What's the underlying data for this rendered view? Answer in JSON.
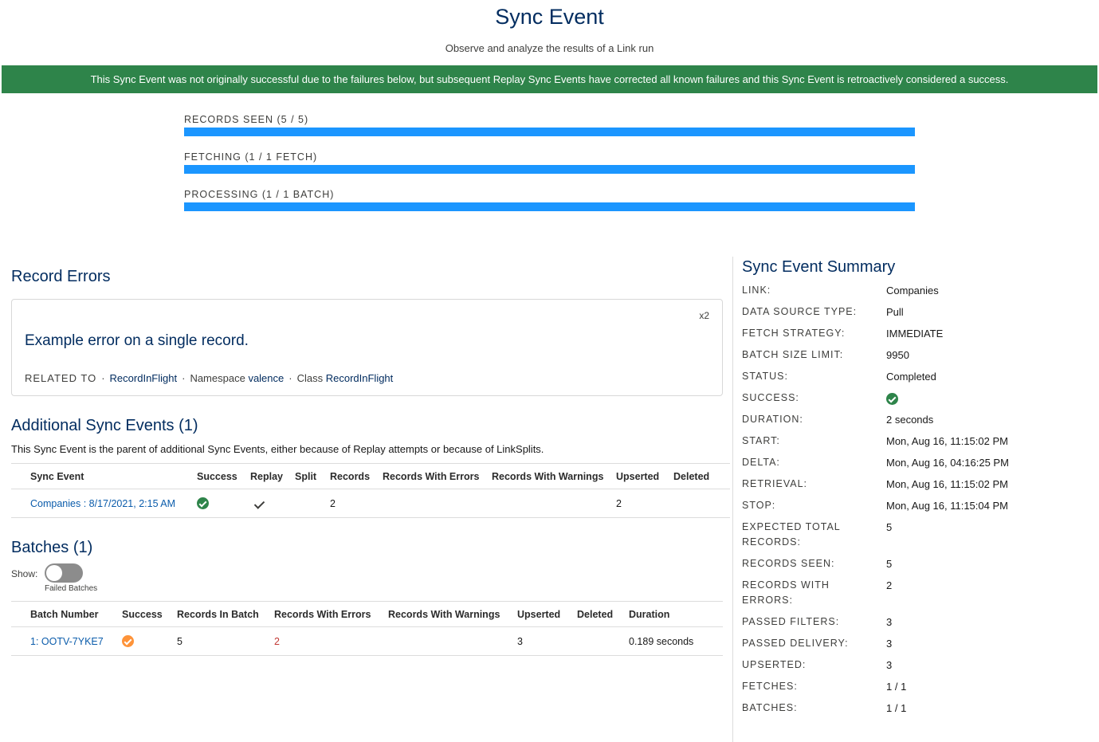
{
  "header": {
    "title": "Sync Event",
    "subtitle": "Observe and analyze the results of a Link run"
  },
  "banner": {
    "text": "This Sync Event was not originally successful due to the failures below, but subsequent Replay Sync Events have corrected all known failures and this Sync Event is retroactively considered a success.",
    "color": "#2e844a"
  },
  "progress": [
    {
      "label": "RECORDS SEEN (5 / 5)",
      "fraction": 1.0
    },
    {
      "label": "FETCHING (1 / 1 FETCH)",
      "fraction": 1.0
    },
    {
      "label": "PROCESSING (1 / 1 BATCH)",
      "fraction": 1.0
    }
  ],
  "record_errors": {
    "heading": "Record Errors",
    "count": "x2",
    "message": "Example error on a single record.",
    "related_to_label": "RELATED TO",
    "related_to_value": "RecordInFlight",
    "namespace_label": "Namespace",
    "namespace_value": "valence",
    "class_label": "Class",
    "class_value": "RecordInFlight"
  },
  "additional": {
    "heading": "Additional Sync Events (1)",
    "description": "This Sync Event is the parent of additional Sync Events, either because of Replay attempts or because of LinkSplits.",
    "columns": [
      "Sync Event",
      "Success",
      "Replay",
      "Split",
      "Records",
      "Records With Errors",
      "Records With Warnings",
      "Upserted",
      "Deleted"
    ],
    "rows": [
      {
        "sync_event": "Companies : 8/17/2021, 2:15 AM",
        "success_icon": "check-circle-green-icon",
        "replay_icon": "checkmark-icon",
        "split": "",
        "records": "2",
        "errors": "",
        "warnings": "",
        "upserted": "2",
        "deleted": ""
      }
    ]
  },
  "batches": {
    "heading": "Batches (1)",
    "show_label": "Show:",
    "toggle_caption": "Failed Batches",
    "toggle_on": false,
    "columns": [
      "Batch Number",
      "Success",
      "Records In Batch",
      "Records With Errors",
      "Records With Warnings",
      "Upserted",
      "Deleted",
      "Duration"
    ],
    "rows": [
      {
        "batch_number": "1: OOTV-7YKE7",
        "success_icon": "check-circle-orange-icon",
        "records": "5",
        "errors": "2",
        "warnings": "",
        "upserted": "3",
        "deleted": "",
        "duration": "0.189 seconds"
      }
    ]
  },
  "summary": {
    "title": "Sync Event Summary",
    "items": [
      {
        "key": "LINK:",
        "value": "Companies",
        "link": true
      },
      {
        "key": "DATA SOURCE TYPE:",
        "value": "Pull"
      },
      {
        "key": "FETCH STRATEGY:",
        "value": "IMMEDIATE"
      },
      {
        "key": "BATCH SIZE LIMIT:",
        "value": "9950"
      },
      {
        "key": "STATUS:",
        "value": "Completed"
      },
      {
        "key": "SUCCESS:",
        "value": "",
        "icon": "check-circle-green-icon"
      },
      {
        "key": "DURATION:",
        "value": "2 seconds"
      },
      {
        "key": "START:",
        "value": "Mon, Aug 16, 11:15:02 PM"
      },
      {
        "key": "DELTA:",
        "value": "Mon, Aug 16, 04:16:25 PM"
      },
      {
        "key": "RETRIEVAL:",
        "value": "Mon, Aug 16, 11:15:02 PM"
      },
      {
        "key": "STOP:",
        "value": "Mon, Aug 16, 11:15:04 PM"
      },
      {
        "key": "EXPECTED TOTAL RECORDS:",
        "value": "5"
      },
      {
        "key": "RECORDS SEEN:",
        "value": "5"
      },
      {
        "key": "RECORDS WITH ERRORS:",
        "value": "2",
        "red": true
      },
      {
        "key": "PASSED FILTERS:",
        "value": "3"
      },
      {
        "key": "PASSED DELIVERY:",
        "value": "3"
      },
      {
        "key": "UPSERTED:",
        "value": "3"
      },
      {
        "key": "FETCHES:",
        "value": "1 / 1"
      },
      {
        "key": "BATCHES:",
        "value": "1 / 1"
      }
    ]
  },
  "colors": {
    "heading": "#032d60",
    "link": "#0b5cab",
    "progress": "#1b96ff",
    "error": "#c23934",
    "success": "#2e844a",
    "warning": "#fe9339"
  }
}
